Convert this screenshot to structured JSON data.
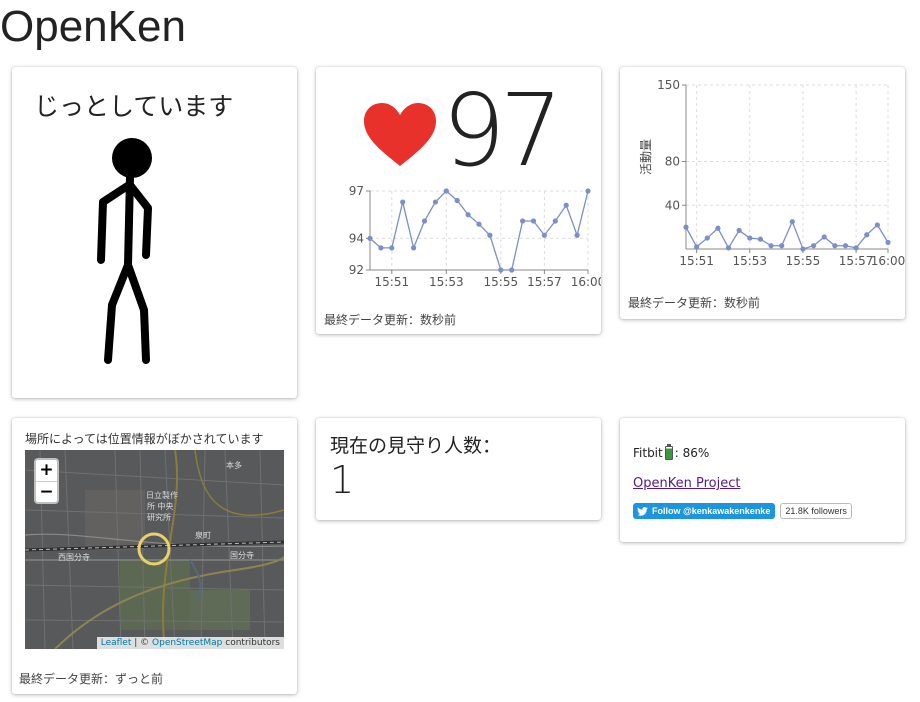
{
  "site": {
    "title": "OpenKen"
  },
  "status_card": {
    "text": "じっとしています"
  },
  "heart_card": {
    "value": "97",
    "update_text": "最終データ更新：数秒前",
    "heart_color": "#e8312b"
  },
  "activity_card": {
    "update_text": "最終データ更新：数秒前"
  },
  "map_card": {
    "caption": "場所によっては位置情報がぼかされています",
    "zoom_in": "+",
    "zoom_out": "−",
    "attribution_leaflet": "Leaflet",
    "attribution_sep": " | © ",
    "attribution_osm": "OpenStreetMap",
    "attribution_contrib": " contributors",
    "labels": [
      "本多",
      "日立製作",
      "所 中央",
      "研究所",
      "西国分寺",
      "国分寺",
      "泉町"
    ],
    "update_text": "最終データ更新：ずっと前"
  },
  "watchers_card": {
    "label": "現在の見守り人数：",
    "count": "1"
  },
  "info_card": {
    "fitbit_label": "Fitbit",
    "fitbit_value": ": 86%",
    "battery_level": 0.86,
    "project_link": "OpenKen Project",
    "twitter_follow": "Follow @kenkawakenkenke",
    "twitter_followers": "21.8K followers",
    "twitter_color": "#1b95e0"
  },
  "chart_data": [
    {
      "type": "line",
      "x_ticks": [
        "15:51",
        "15:53",
        "15:55",
        "15:57",
        "16:00"
      ],
      "y_ticks": [
        "92",
        "94",
        "97"
      ],
      "ylim": [
        92,
        97
      ],
      "series": [
        {
          "values": [
            94,
            93.4,
            93.4,
            96.3,
            93.4,
            95.1,
            96.3,
            97,
            96.4,
            95.5,
            94.9,
            94.2,
            92,
            92,
            95.1,
            95.1,
            94.2,
            95.1,
            96.1,
            94.2,
            97
          ]
        }
      ],
      "color": "#7b8fc8",
      "grid": true
    },
    {
      "type": "line",
      "ylabel": "活動量",
      "x_ticks": [
        "15:51",
        "15:53",
        "15:55",
        "15:57",
        "16:00"
      ],
      "y_ticks": [
        "40",
        "80",
        "150"
      ],
      "ylim": [
        0,
        150
      ],
      "series": [
        {
          "values": [
            20,
            2,
            10,
            19,
            1,
            17,
            10,
            9,
            3,
            3,
            25,
            0,
            3,
            11,
            3,
            3,
            1,
            13,
            22,
            6
          ]
        }
      ],
      "color": "#7b8fc8",
      "grid": true
    }
  ]
}
